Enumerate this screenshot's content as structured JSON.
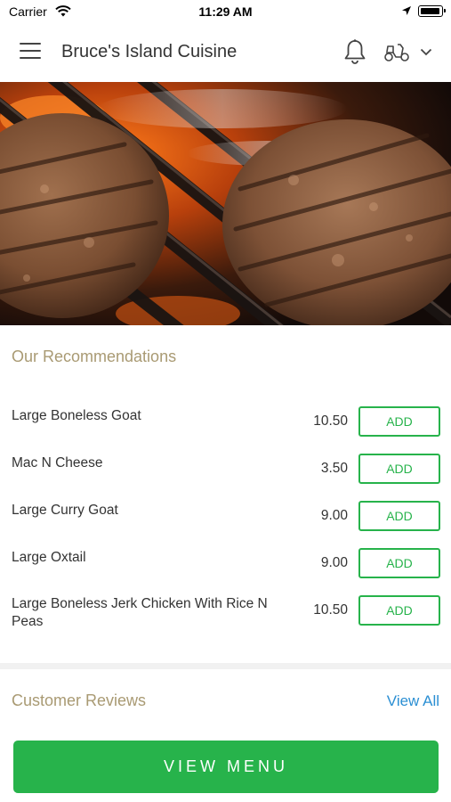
{
  "status_bar": {
    "carrier": "Carrier",
    "time": "11:29 AM"
  },
  "header": {
    "title": "Bruce's Island Cuisine"
  },
  "recommendations": {
    "title": "Our Recommendations",
    "add_label": "ADD",
    "items": [
      {
        "name": "Large Boneless Goat",
        "price": "10.50"
      },
      {
        "name": "Mac N Cheese",
        "price": "3.50"
      },
      {
        "name": "Large Curry Goat",
        "price": "9.00"
      },
      {
        "name": "Large Oxtail",
        "price": "9.00"
      },
      {
        "name": "Large Boneless Jerk Chicken With Rice N Peas",
        "price": "10.50"
      }
    ]
  },
  "reviews": {
    "title": "Customer Reviews",
    "view_all": "View All"
  },
  "footer": {
    "view_menu": "VIEW MENU"
  },
  "colors": {
    "accent_green": "#27b34b",
    "section_title": "#a99a73",
    "link_blue": "#2b8fd3"
  }
}
